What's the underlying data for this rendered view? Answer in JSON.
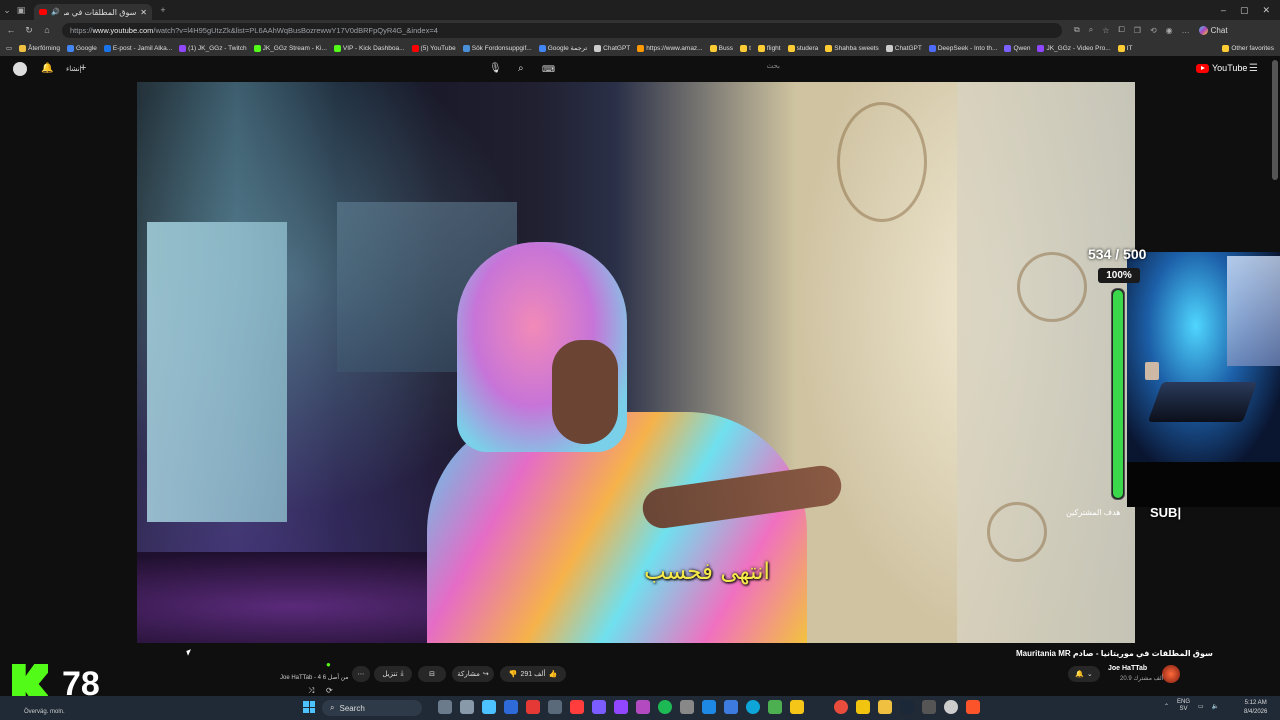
{
  "browser": {
    "tab_title": "سوق المطلقات في موريتانيا -",
    "url_prefix": "https://",
    "url_host": "www.youtube.com",
    "url_rest": "/watch?v=l4H95gUtzZk&list=PL6AAhWqBusBozrewwY17V0dBRFpQyR4G_&index=4",
    "copilot_label": "Chat",
    "bookmarks": [
      {
        "label": "Återförning",
        "color": "#f0c040"
      },
      {
        "label": "Google",
        "color": "#4285f4"
      },
      {
        "label": "E-post - Jamil Alka...",
        "color": "#1a73e8"
      },
      {
        "label": "(1) JK_GGz - Twitch",
        "color": "#9146ff"
      },
      {
        "label": "JK_GGz Stream - Ki...",
        "color": "#53fc18"
      },
      {
        "label": "VIP - Kick Dashboa...",
        "color": "#53fc18"
      },
      {
        "label": "(5) YouTube",
        "color": "#ff0000"
      },
      {
        "label": "Sök Fordonsuppgif...",
        "color": "#4a90d9"
      },
      {
        "label": "Google ترجمة",
        "color": "#4285f4"
      },
      {
        "label": "ChatGPT",
        "color": "#cccccc"
      },
      {
        "label": "https://www.amaz...",
        "color": "#ff9900"
      },
      {
        "label": "Buss",
        "color": "#ffcc33"
      },
      {
        "label": "t",
        "color": "#ffcc33"
      },
      {
        "label": "flight",
        "color": "#ffcc33"
      },
      {
        "label": "studera",
        "color": "#ffcc33"
      },
      {
        "label": "Shahba sweets",
        "color": "#ffcc33"
      },
      {
        "label": "ChatGPT",
        "color": "#cccccc"
      },
      {
        "label": "DeepSeek - Into th...",
        "color": "#4d6bfe"
      },
      {
        "label": "Qwen",
        "color": "#7b61ff"
      },
      {
        "label": "JK_GGz - Video Pro...",
        "color": "#9146ff"
      },
      {
        "label": "IT",
        "color": "#ffcc33"
      }
    ],
    "other_favorites": "Other favorites"
  },
  "youtube": {
    "create_label": "إنشاء",
    "search_placeholder": "بحث",
    "logo_text": "YouTube",
    "subtitle": "انتهى فحسب",
    "video_title": "سوق المطلقات في موريتانيا - صادم Mauritania MR",
    "channel_name": "Joe HaTTab",
    "channel_subs": "20.9 ألف مشترك",
    "like_count": "291 ألف",
    "share_label": "مشاركة",
    "download_label": "تنزيل",
    "playlist_meta": "Joe HaTTab - 4 من أصل 6"
  },
  "overlay": {
    "sub_goal": "534 / 500",
    "sub_pct_text": "100%",
    "sub_fraction": 1.0,
    "sub_label": "SUB|",
    "sub_ar": "هدف المشتركين",
    "kick_viewers": "78",
    "kick_sub": "Överväg. moln."
  },
  "taskbar": {
    "search_label": "Search",
    "lang": "ENG",
    "lang_sub": "SV",
    "time": "5:12 AM",
    "date": "8/4/2026"
  },
  "colors": {
    "accent_green": "#53fc18",
    "youtube_red": "#ff0000",
    "subtitle_yellow": "#f5e94a"
  }
}
